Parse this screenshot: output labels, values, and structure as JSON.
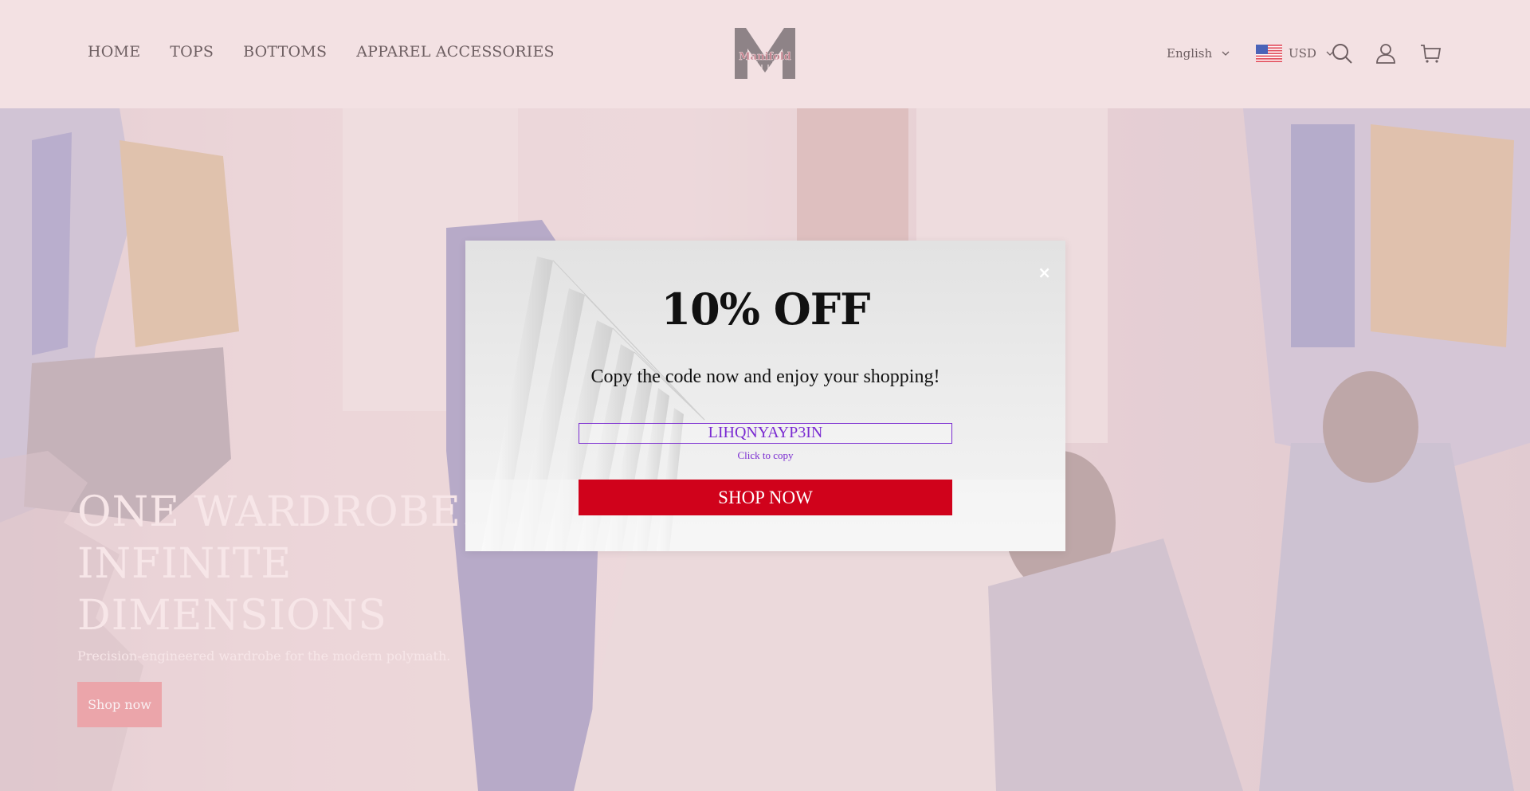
{
  "header": {
    "nav": [
      "HOME",
      "TOPS",
      "BOTTOMS",
      "APPAREL ACCESSORIES"
    ],
    "logo_text": "Manifold",
    "language": "English",
    "currency": "USD",
    "icons": [
      "search-icon",
      "account-icon",
      "cart-icon"
    ]
  },
  "hero": {
    "title_lines": [
      "ONE WARDROBE.",
      "INFINITE",
      "DIMENSIONS"
    ],
    "subtitle": "Precision-engineered wardrobe for the modern polymath.",
    "button": "Shop now"
  },
  "modal": {
    "title": "10% OFF",
    "text": "Copy the code now and enjoy your shopping!",
    "code": "LIHQNYAYP3IN",
    "copy_hint": "Click to copy",
    "button": "SHOP NOW",
    "close": "×"
  },
  "colors": {
    "header_bg": "#f3e1e3",
    "accent_red": "#d0021b",
    "code_purple": "#7a2bd1",
    "hero_button": "#e88a90"
  }
}
